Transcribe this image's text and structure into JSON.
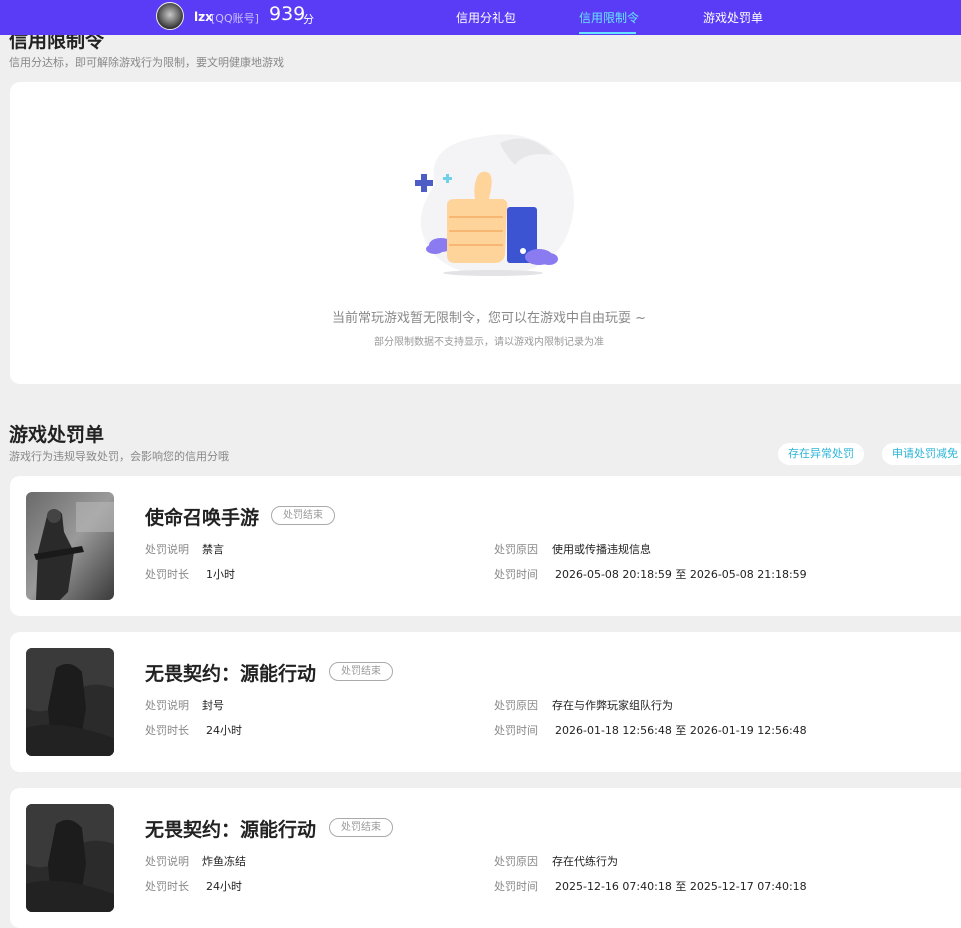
{
  "header": {
    "user_name": "lzx",
    "account_type": "[QQ账号]",
    "score": "939",
    "score_unit": "分",
    "tabs": [
      {
        "label": "信用分礼包",
        "active": false
      },
      {
        "label": "信用限制令",
        "active": true
      },
      {
        "label": "游戏处罚单",
        "active": false
      }
    ],
    "colors": {
      "bar": "#5b3cf6",
      "active_tab": "#66e3ff"
    }
  },
  "restriction": {
    "title": "信用限制令",
    "subtitle": "信用分达标，即可解除游戏行为限制，要文明健康地游戏",
    "empty_message": "当前常玩游戏暂无限制令，您可以在游戏中自由玩耍 ~",
    "empty_note": "部分限制数据不支持显示，请以游戏内限制记录为准",
    "illustration_icon": "thumbs-up-icon"
  },
  "penalties": {
    "title": "游戏处罚单",
    "subtitle": "游戏行为违规导致处罚，会影响您的信用分哦",
    "buttons": {
      "abnormal": "存在异常处罚",
      "appeal": "申请处罚减免"
    },
    "labels": {
      "desc": "处罚说明",
      "reason": "处罚原因",
      "duration": "处罚时长",
      "time": "处罚时间"
    },
    "items": [
      {
        "game": "使命召唤手游",
        "status": "处罚结束",
        "desc": "禁言",
        "reason": "使用或传播违规信息",
        "duration": "1小时",
        "time": "2026-05-08 20:18:59 至 2026-05-08 21:18:59"
      },
      {
        "game": "无畏契约：源能行动",
        "status": "处罚结束",
        "desc": "封号",
        "reason": "存在与作弊玩家组队行为",
        "duration": "24小时",
        "time": "2026-01-18 12:56:48 至 2026-01-19 12:56:48"
      },
      {
        "game": "无畏契约：源能行动",
        "status": "处罚结束",
        "desc": "炸鱼冻结",
        "reason": "存在代练行为",
        "duration": "24小时",
        "time": "2025-12-16 07:40:18 至 2025-12-17 07:40:18"
      }
    ]
  }
}
